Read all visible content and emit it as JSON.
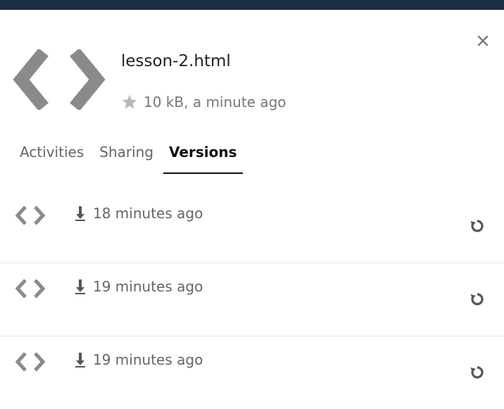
{
  "header": {
    "close_icon": "close-icon",
    "file_name": "lesson-2.html",
    "file_icon": "code-icon",
    "favorite_icon": "star-icon",
    "file_meta": "10 kB, a minute ago"
  },
  "tabs": [
    {
      "label": "Activities",
      "active": false
    },
    {
      "label": "Sharing",
      "active": false
    },
    {
      "label": "Versions",
      "active": true
    }
  ],
  "versions": [
    {
      "time": "18 minutes ago",
      "download_icon": "download-icon",
      "restore_icon": "restore-icon"
    },
    {
      "time": "19 minutes ago",
      "download_icon": "download-icon",
      "restore_icon": "restore-icon"
    },
    {
      "time": "19 minutes ago",
      "download_icon": "download-icon",
      "restore_icon": "restore-icon"
    }
  ],
  "colors": {
    "topbar": "#1d2d44",
    "icon_gray": "#8a8a8a",
    "text_secondary": "#777777",
    "active_tab": "#111111"
  }
}
